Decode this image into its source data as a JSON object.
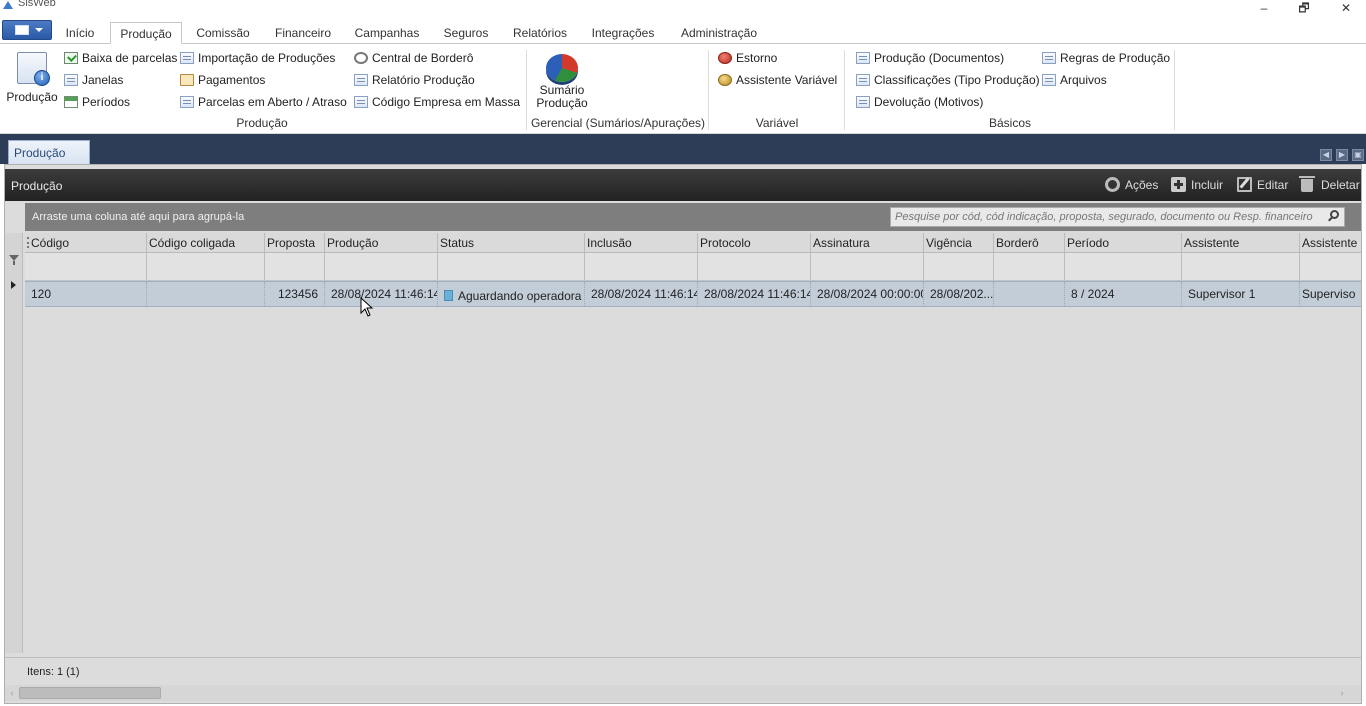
{
  "window": {
    "title": "SisWeb",
    "minimize": "–",
    "restore": "🗗",
    "close": "✕"
  },
  "ribbon_tabs": [
    {
      "label": "Início"
    },
    {
      "label": "Produção"
    },
    {
      "label": "Comissão"
    },
    {
      "label": "Financeiro"
    },
    {
      "label": "Campanhas"
    },
    {
      "label": "Seguros"
    },
    {
      "label": "Relatórios"
    },
    {
      "label": "Integrações"
    },
    {
      "label": "Administração"
    }
  ],
  "ribbon": {
    "producao_big": "Produção",
    "col1": [
      "Baixa de parcelas",
      "Janelas",
      "Períodos"
    ],
    "col2": [
      "Importação de Produções",
      "Pagamentos",
      "Parcelas em Aberto / Atraso"
    ],
    "col3": [
      "Central de Borderô",
      "Relatório Produção",
      "Código Empresa em Massa"
    ],
    "group_producao": "Produção",
    "sumario_line1": "Sumário",
    "sumario_line2": "Produção",
    "group_gerencial": "Gerencial (Sumários/Apurações)",
    "variavel_items": [
      "Estorno",
      "Assistente Variável"
    ],
    "group_variavel": "Variável",
    "basicos_col1": [
      "Produção (Documentos)",
      "Classificações (Tipo Produção)",
      "Devolução (Motivos)"
    ],
    "basicos_col2": [
      "Regras de Produção",
      "Arquivos"
    ],
    "group_basicos": "Básicos"
  },
  "doc_tab": {
    "label": "Produção"
  },
  "panel": {
    "title": "Produção",
    "actions": {
      "acoes": "Ações",
      "incluir": "Incluir",
      "editar": "Editar",
      "deletar": "Deletar"
    },
    "group_hint": "Arraste uma coluna até aqui para agrupá-la",
    "search_placeholder": "Pesquise por cód, cód indicação, proposta, segurado, documento ou Resp. financeiro"
  },
  "grid": {
    "columns": [
      "Código",
      "Código coligada",
      "Proposta",
      "Produção",
      "Status",
      "Inclusão",
      "Protocolo",
      "Assinatura",
      "Vigência",
      "Borderô",
      "Período",
      "Assistente",
      "Assistente"
    ],
    "row": {
      "codigo": "120",
      "codigo_coligada": "",
      "proposta": "123456",
      "producao": "28/08/2024 11:46:14",
      "status": "Aguardando operadora",
      "inclusao": "28/08/2024 11:46:14",
      "protocolo": "28/08/2024 11:46:14",
      "assinatura": "28/08/2024 00:00:00",
      "vigencia": "28/08/202...",
      "bordero": "",
      "periodo": "8 / 2024",
      "assistente": "Supervisor 1",
      "assistente2": "Superviso"
    }
  },
  "footer": {
    "items": "Itens: 1 (1)"
  },
  "colors": {
    "ribbon_blue": "#2b5aa6",
    "band": "#2d3d57",
    "header_dark": "#222222",
    "row_selected": "#c3cdd8",
    "status_badge": "#6ab0d8"
  }
}
